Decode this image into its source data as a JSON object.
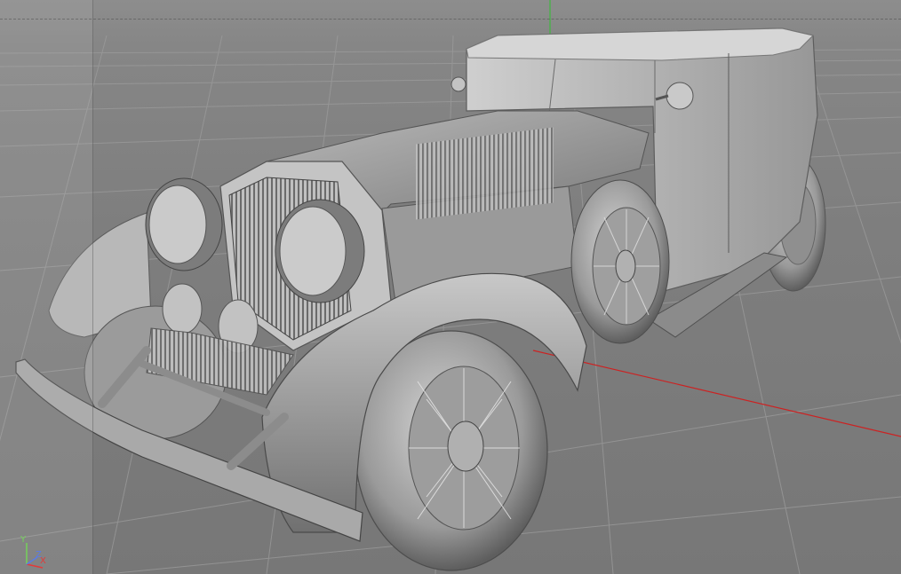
{
  "viewport": {
    "background": "#7f7f7f",
    "grid_color": "#9c9c9c",
    "x_axis_color": "#cc2222",
    "y_axis_color": "#3fb83f",
    "model": "vintage-car-icon",
    "shading": "gray-clay"
  },
  "axis_gizmo": {
    "x_label": "X",
    "y_label": "Y",
    "z_label": "Z",
    "x_color": "#e23a3a",
    "y_color": "#74d25a",
    "z_color": "#5a7be6"
  }
}
